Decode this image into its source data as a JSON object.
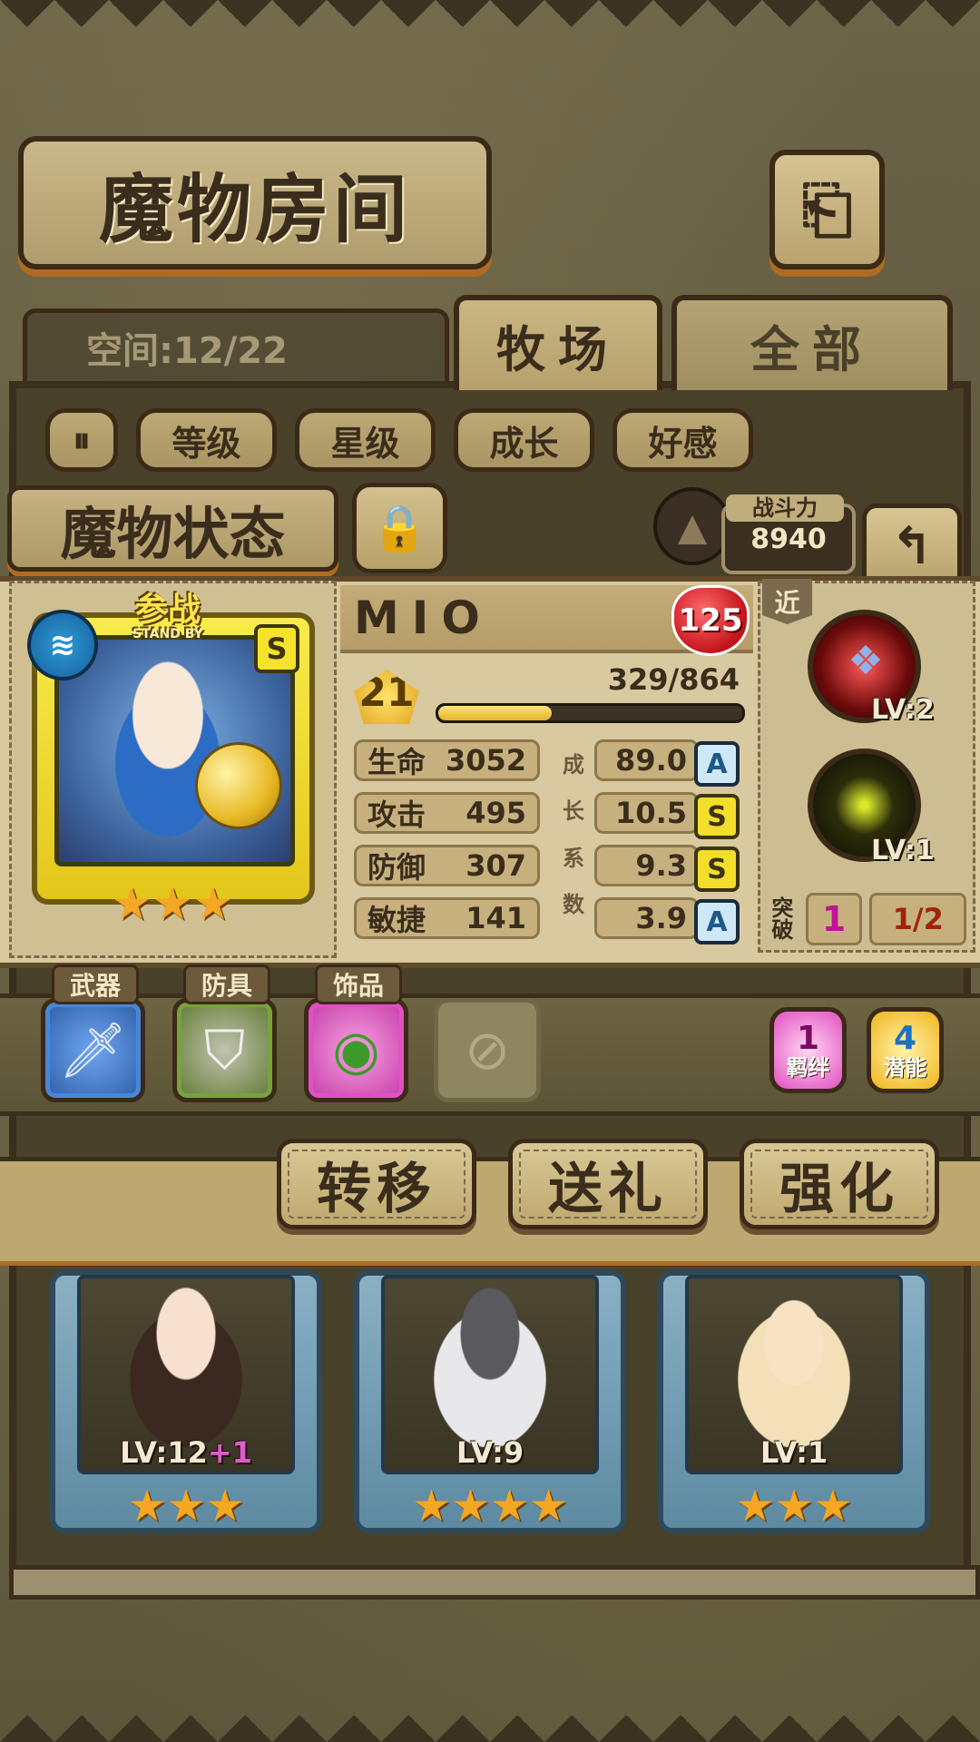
{
  "header": {
    "title": "魔物房间",
    "back_icon": "⎗"
  },
  "space": {
    "label": "空间:12/22"
  },
  "tabs": [
    {
      "label": "牧场",
      "active": true
    },
    {
      "label": "全部",
      "active": false
    }
  ],
  "filters": {
    "toggle_icon": "⏸",
    "items": [
      "等级",
      "星级",
      "成长",
      "好感"
    ]
  },
  "status": {
    "title": "魔物状态",
    "lock_icon": "🔒",
    "power_label": "战斗力",
    "power_value": "8940",
    "back_icon": "↰"
  },
  "monster": {
    "name": "MIO",
    "affection": "125",
    "standby_cn": "参战",
    "standby_en": "STAND BY",
    "rank": "S",
    "stars": "★★★",
    "level": "21",
    "exp_text": "329/864",
    "exp_fraction": 0.38,
    "element_icon": "≋",
    "stats": [
      {
        "label": "生命",
        "value": "3052",
        "growth": "89.0",
        "grade": "A"
      },
      {
        "label": "攻击",
        "value": "495",
        "growth": "10.5",
        "grade": "S"
      },
      {
        "label": "防御",
        "value": "307",
        "growth": "9.3",
        "grade": "S"
      },
      {
        "label": "敏捷",
        "value": "141",
        "growth": "3.9",
        "grade": "A"
      }
    ],
    "growth_vertical": [
      "成",
      "长",
      "系",
      "数"
    ]
  },
  "skills": {
    "range": "近",
    "items": [
      {
        "level": "LV:2",
        "icon": "paw-icon"
      },
      {
        "level": "LV:1",
        "icon": "lightning-icon"
      }
    ],
    "breakthrough_label": "突破",
    "breakthrough_value": "1",
    "breakthrough_fraction": "1/2"
  },
  "equipment": {
    "weapon_label": "武器",
    "armor_label": "防具",
    "accessory_label": "饰品",
    "weapon_icon": "🗡",
    "armor_icon": "⛉",
    "accessory_icon": "◉",
    "empty_icon": "⊘"
  },
  "badges": {
    "bond_num": "1",
    "bond_label": "羁绊",
    "potential_num": "4",
    "potential_label": "潜能"
  },
  "actions": {
    "transfer": "转移",
    "gift": "送礼",
    "enhance": "强化"
  },
  "roster": [
    {
      "level": "LV:12",
      "bonus": "+1",
      "stars": "★★★"
    },
    {
      "level": "LV:9",
      "bonus": "",
      "stars": "★★★★"
    },
    {
      "level": "LV:1",
      "bonus": "",
      "stars": "★★★"
    }
  ]
}
